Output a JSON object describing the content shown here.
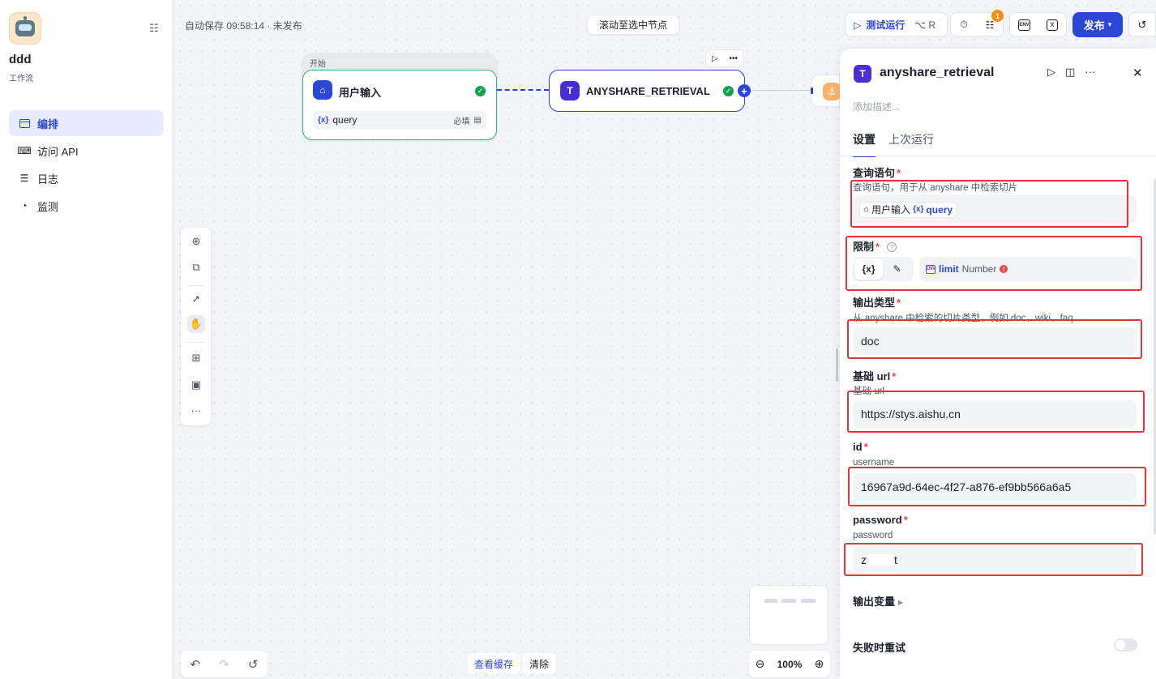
{
  "app": {
    "name": "ddd",
    "type": "工作流"
  },
  "nav": [
    {
      "label": "编排",
      "icon": "layout-icon",
      "active": true
    },
    {
      "label": "访问 API",
      "icon": "terminal-icon"
    },
    {
      "label": "日志",
      "icon": "log-icon"
    },
    {
      "label": "监测",
      "icon": "gauge-icon"
    }
  ],
  "topbar": {
    "autosave": "自动保存 09:58:14 · 未发布",
    "scroll_to_node": "滚动至选中节点",
    "test_run": "测试运行",
    "test_run_shortcut": "⌥ R",
    "checklist_badge": "1",
    "env_icon": "ENV",
    "publish": "发布"
  },
  "canvas": {
    "start_group_label": "开始",
    "start_node": {
      "title": "用户输入",
      "var_name": "query",
      "var_required": "必填"
    },
    "retrieval_node": {
      "title": "ANYSHARE_RETRIEVAL"
    },
    "bottom": {
      "view_cache": "查看缓存",
      "clear": "清除",
      "zoom": "100%"
    }
  },
  "panel": {
    "title": "anyshare_retrieval",
    "desc_placeholder": "添加描述...",
    "tabs": [
      "设置",
      "上次运行"
    ],
    "fields": {
      "query": {
        "label": "查询语句",
        "hint": "查询语句，用于从 anyshare 中检索切片",
        "chip_node": "用户输入",
        "chip_var": "query"
      },
      "limit": {
        "label": "限制",
        "seg_var": "{x}",
        "env_tag": "ENV",
        "ref_name": "limit",
        "ref_type": "Number"
      },
      "output_type": {
        "label": "输出类型",
        "hint": "从 anyshare 中检索的切片类型，例如 doc、wiki、faq",
        "value": "doc"
      },
      "base_url": {
        "label": "基础 url",
        "hint": "基础 url",
        "value": "https://stys.aishu.cn"
      },
      "id": {
        "label": "id",
        "hint": "username",
        "value": "16967a9d-64ec-4f27-a876-ef9bb566a6a5"
      },
      "password": {
        "label": "password",
        "hint": "password",
        "value_start": "z",
        "value_end": "t"
      }
    },
    "output_vars": "输出变量",
    "retry_on_fail": "失败时重试"
  },
  "colors": {
    "accent": "#2c46d6",
    "success": "#12a150",
    "annotation": "#e5323b"
  }
}
